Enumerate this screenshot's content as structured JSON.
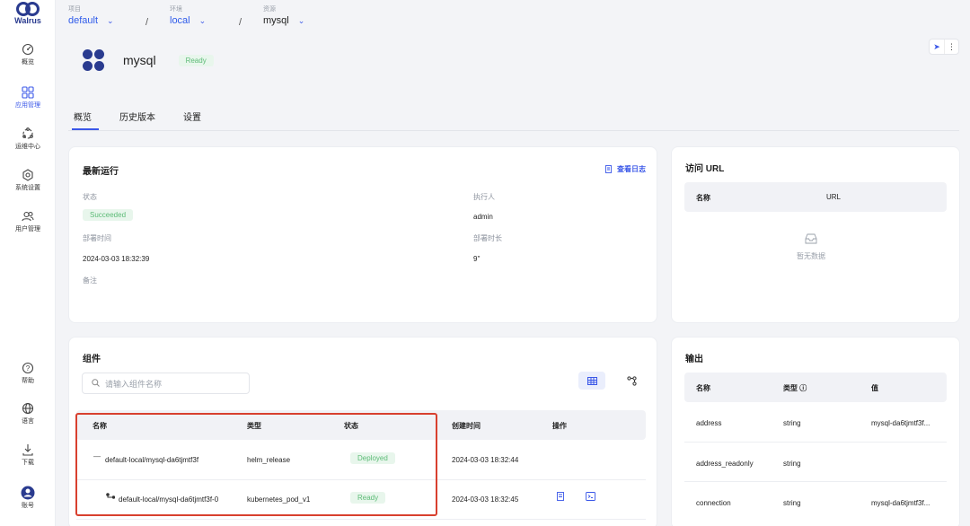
{
  "app": {
    "logo_text": "Walrus"
  },
  "sidebar": {
    "items": [
      {
        "label": "概览",
        "icon": "dashboard-icon"
      },
      {
        "label": "应用管理",
        "icon": "apps-icon"
      },
      {
        "label": "运维中心",
        "icon": "ops-icon"
      },
      {
        "label": "系统设置",
        "icon": "settings-icon"
      },
      {
        "label": "用户管理",
        "icon": "users-icon"
      }
    ],
    "bottom": [
      {
        "label": "帮助",
        "icon": "help-icon"
      },
      {
        "label": "语言",
        "icon": "globe-icon"
      },
      {
        "label": "下载",
        "icon": "download-icon"
      },
      {
        "label": "账号",
        "icon": "account-icon"
      }
    ]
  },
  "breadcrumb": {
    "project_label": "项目",
    "project": "default",
    "env_label": "环境",
    "env": "local",
    "resource_label": "资源",
    "resource": "mysql",
    "separator": "/"
  },
  "resource": {
    "name": "mysql",
    "status": "Ready"
  },
  "tabs": [
    "概览",
    "历史版本",
    "设置"
  ],
  "latest_run": {
    "title": "最新运行",
    "view_logs": "查看日志",
    "status_label": "状态",
    "status": "Succeeded",
    "executor_label": "执行人",
    "executor": "admin",
    "deploy_time_label": "部署时间",
    "deploy_time": "2024-03-03 18:32:39",
    "duration_label": "部署时长",
    "duration": "9''",
    "note_label": "备注"
  },
  "access_url": {
    "title": "访问 URL",
    "col_name": "名称",
    "col_url": "URL",
    "empty": "暂无数据"
  },
  "components": {
    "title": "组件",
    "search_placeholder": "请输入组件名称",
    "columns": [
      "名称",
      "类型",
      "状态",
      "创建时间",
      "操作"
    ],
    "rows": [
      {
        "name": "default-local/mysql-da6tjmtf3f",
        "type": "helm_release",
        "status": "Deployed",
        "created": "2024-03-03 18:32:44"
      },
      {
        "name": "default-local/mysql-da6tjmtf3f-0",
        "type": "kubernetes_pod_v1",
        "status": "Ready",
        "created": "2024-03-03 18:32:45"
      }
    ]
  },
  "outputs": {
    "title": "输出",
    "columns": [
      "名称",
      "类型 ⓘ",
      "值"
    ],
    "rows": [
      {
        "name": "address",
        "type": "string",
        "value": "mysql-da6tjmtf3f..."
      },
      {
        "name": "address_readonly",
        "type": "string",
        "value": ""
      },
      {
        "name": "connection",
        "type": "string",
        "value": "mysql-da6tjmtf3f..."
      }
    ]
  },
  "colors": {
    "accent": "#3a57e8",
    "success_bg": "#e8f6ec",
    "success_text": "#5cbb76",
    "highlight": "#d8402f"
  }
}
